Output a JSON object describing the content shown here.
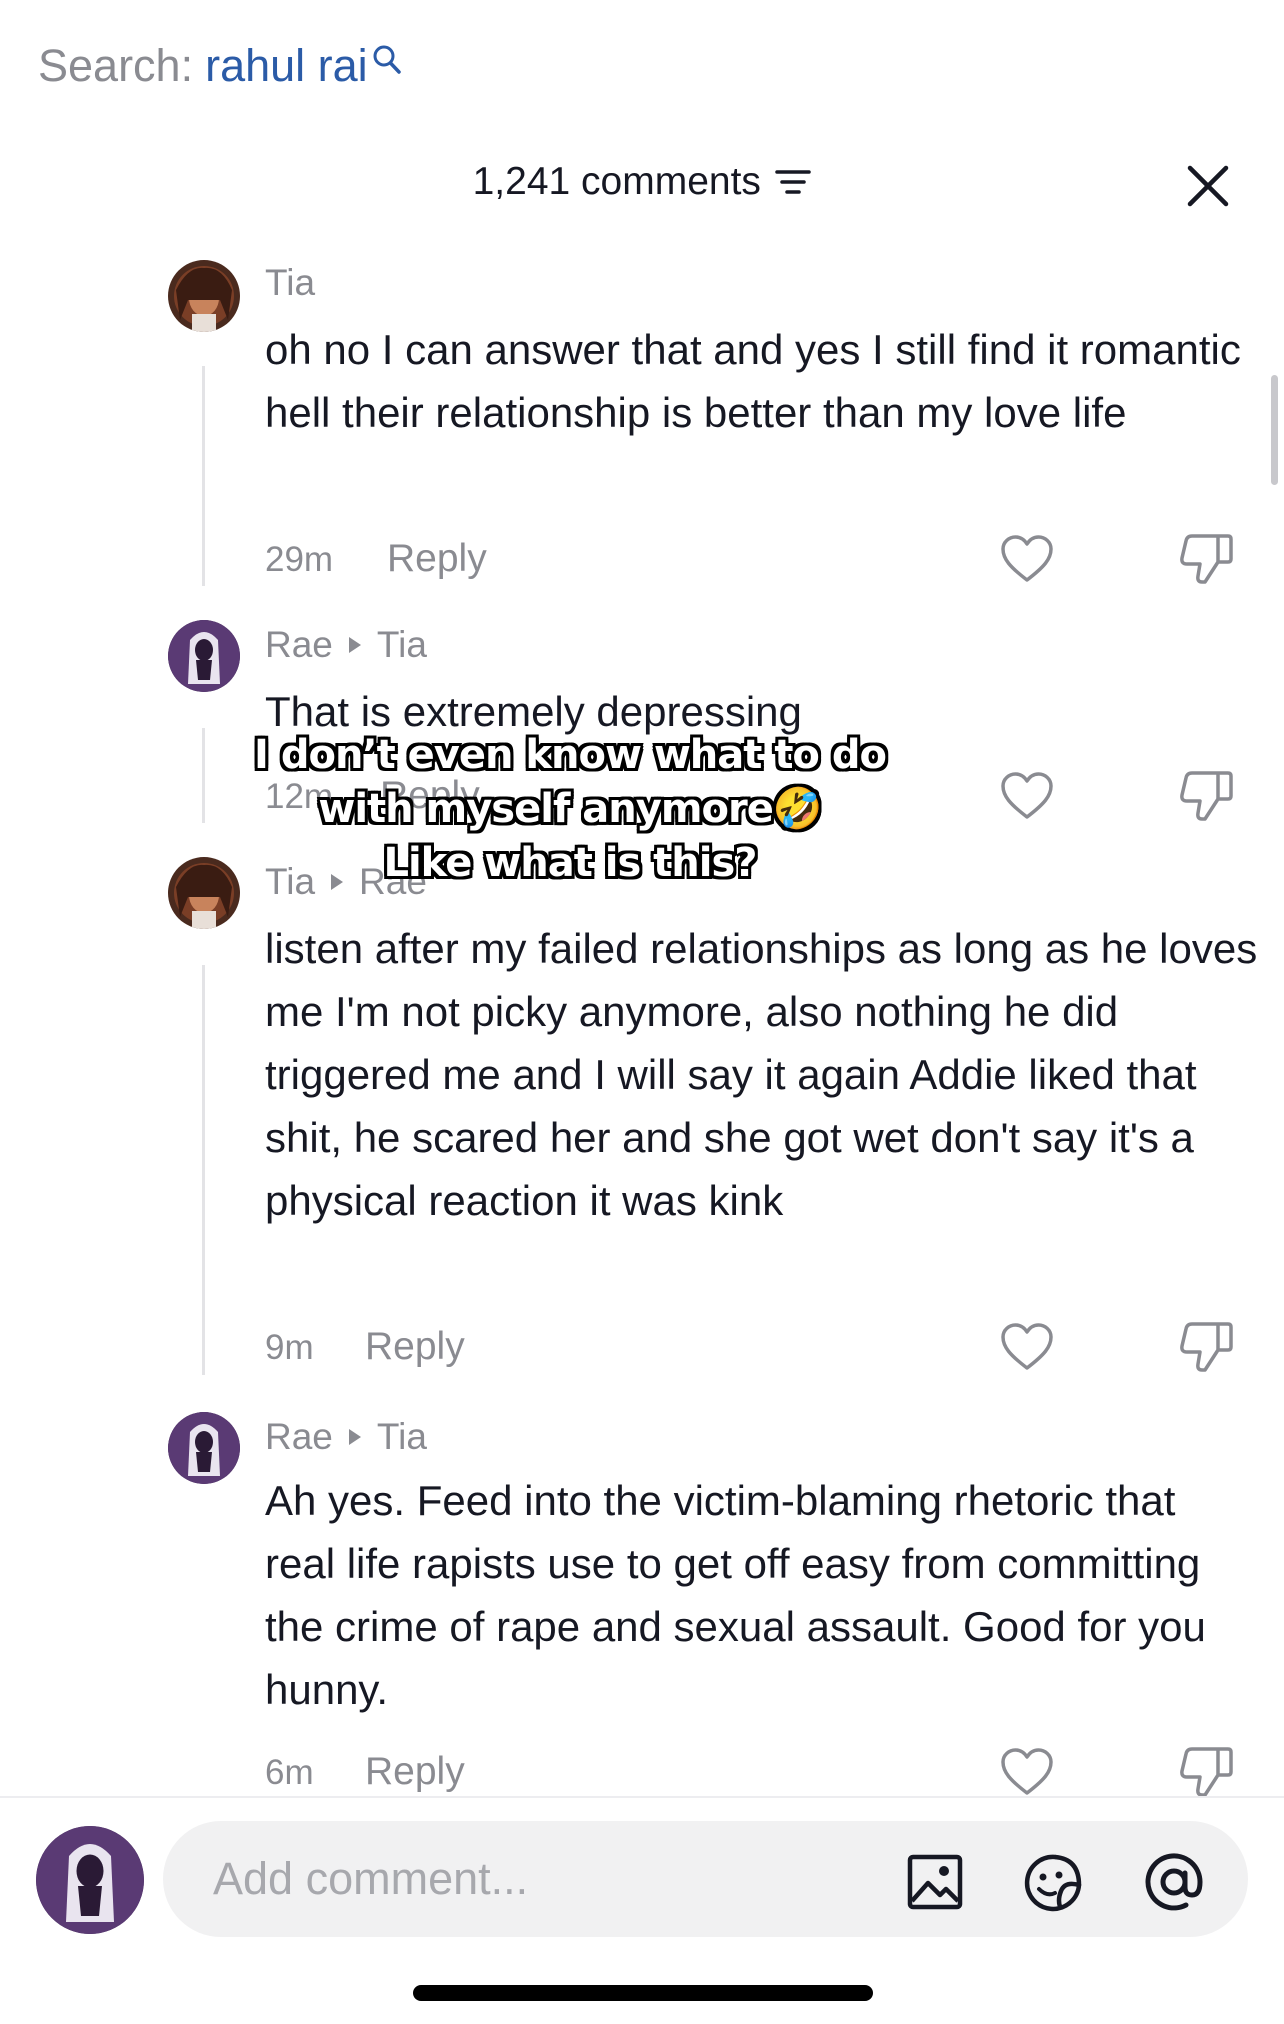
{
  "search": {
    "prefix": "Search:",
    "query": "rahul rai"
  },
  "header": {
    "count_label": "1,241 comments"
  },
  "comments": [
    {
      "user": "Tia",
      "reply_to": "",
      "text": "oh no I can answer that and yes I still find it romantic hell their relationship is better than my love life",
      "time": "29m",
      "reply_label": "Reply"
    },
    {
      "user": "Rae",
      "reply_to": "Tia",
      "text": "That is extremely depressing",
      "time": "12m",
      "reply_label": "Reply"
    },
    {
      "user": "Tia",
      "reply_to": "Rae",
      "text": "listen after my failed relationships as long as he loves me I'm not picky anymore, also nothing he did triggered me and I will say it again Addie liked that shit, he scared her and she got wet don't say it's a physical reaction it was kink",
      "time": "9m",
      "reply_label": "Reply"
    },
    {
      "user": "Rae",
      "reply_to": "Tia",
      "text": "Ah yes. Feed into the victim-blaming rhetoric that real life rapists use to get off easy from committing the crime of rape and sexual assault. Good for you hunny.",
      "time": "6m",
      "reply_label": "Reply"
    }
  ],
  "overlay_caption": {
    "line1": "I don’t even know what to do",
    "line2": "with myself anymore🤣",
    "line3": "Like what is this?"
  },
  "composer": {
    "placeholder": "Add comment..."
  },
  "icons": [
    "search-icon",
    "sort-icon",
    "close-icon",
    "heart-icon",
    "dislike-icon",
    "image-icon",
    "emoji-icon",
    "mention-icon"
  ],
  "colors": {
    "search_query": "#2b5ba7",
    "muted_text": "#8a8b91",
    "body_text": "#161823",
    "input_bg": "#f1f1f2"
  }
}
